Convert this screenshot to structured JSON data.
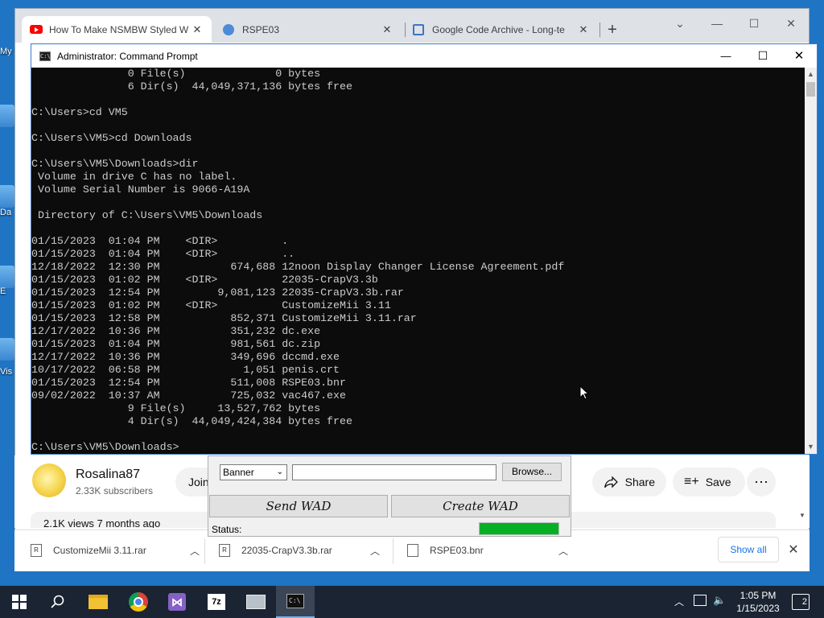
{
  "desktop": {
    "labels": [
      "My",
      "Da",
      "E",
      "Vis"
    ]
  },
  "browser": {
    "tabs": [
      {
        "title": "How To Make NSMBW Styled W",
        "icon": "youtube-icon"
      },
      {
        "title": "RSPE03",
        "icon": "page-icon"
      },
      {
        "title": "Google Code Archive - Long-te",
        "icon": "google-code-icon"
      }
    ],
    "new_tab": "+",
    "window_controls": {
      "dropdown": "⌄",
      "minimize": "—",
      "maximize": "☐",
      "close": "✕"
    }
  },
  "youtube": {
    "channel_name": "Rosalina87",
    "subscribers": "2.33K subscribers",
    "join_label": "Join",
    "share_label": "Share",
    "save_label": "Save",
    "more_label": "⋯",
    "views_text": "2.1K views  7 months ago"
  },
  "downloads": {
    "items": [
      {
        "name": "CustomizeMii 3.11.rar",
        "icon": "rar-icon"
      },
      {
        "name": "22035-CrapV3.3b.rar",
        "icon": "rar-icon"
      },
      {
        "name": "RSPE03.bnr",
        "icon": "file-icon"
      }
    ],
    "show_all": "Show all",
    "close": "✕"
  },
  "cmd": {
    "title": "Administrator: Command Prompt",
    "controls": {
      "minimize": "—",
      "maximize": "☐",
      "close": "✕"
    },
    "output": "               0 File(s)              0 bytes\n               6 Dir(s)  44,049,371,136 bytes free\n\nC:\\Users>cd VM5\n\nC:\\Users\\VM5>cd Downloads\n\nC:\\Users\\VM5\\Downloads>dir\n Volume in drive C has no label.\n Volume Serial Number is 9066-A19A\n\n Directory of C:\\Users\\VM5\\Downloads\n\n01/15/2023  01:04 PM    <DIR>          .\n01/15/2023  01:04 PM    <DIR>          ..\n12/18/2022  12:30 PM           674,688 12noon Display Changer License Agreement.pdf\n01/15/2023  01:02 PM    <DIR>          22035-CrapV3.3b\n01/15/2023  12:54 PM         9,081,123 22035-CrapV3.3b.rar\n01/15/2023  01:02 PM    <DIR>          CustomizeMii 3.11\n01/15/2023  12:58 PM           852,371 CustomizeMii 3.11.rar\n12/17/2022  10:36 PM           351,232 dc.exe\n01/15/2023  01:04 PM           981,561 dc.zip\n12/17/2022  10:36 PM           349,696 dccmd.exe\n10/17/2022  06:58 PM             1,051 penis.crt\n01/15/2023  12:54 PM           511,008 RSPE03.bnr\n09/02/2022  10:37 AM           725,032 vac467.exe\n               9 File(s)     13,527,762 bytes\n               4 Dir(s)  44,049,424,384 bytes free\n\nC:\\Users\\VM5\\Downloads>"
  },
  "wad_tool": {
    "type_value": "Banner",
    "path_value": "",
    "browse_label": "Browse...",
    "send_label": "Send WAD",
    "create_label": "Create WAD",
    "status_label": "Status:",
    "progress": 1.0
  },
  "taskbar": {
    "apps": [
      "start-icon",
      "search-icon",
      "file-explorer-icon",
      "chrome-icon",
      "visual-studio-icon",
      "7zip-icon",
      "app-icon",
      "command-prompt-icon"
    ],
    "time": "1:05 PM",
    "date": "1/15/2023",
    "notification_count": "2"
  }
}
